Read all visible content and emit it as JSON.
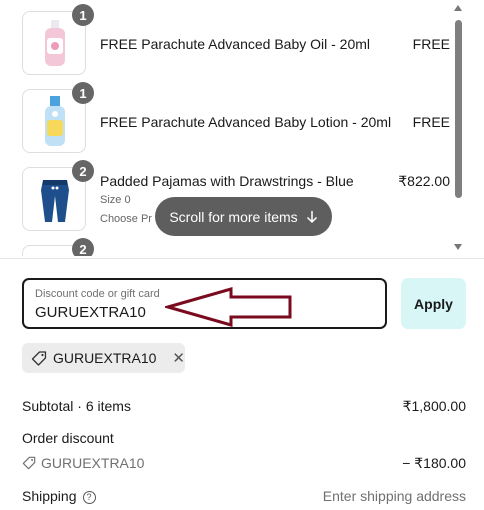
{
  "cart": {
    "items": [
      {
        "quantity": "1",
        "title": "FREE Parachute Advanced Baby Oil - 20ml",
        "price": "FREE",
        "image_icon": "baby-oil-bottle"
      },
      {
        "quantity": "1",
        "title": "FREE Parachute Advanced Baby Lotion - 20ml",
        "price": "FREE",
        "image_icon": "baby-lotion-bottle"
      },
      {
        "quantity": "2",
        "title": "Padded Pajamas with Drawstrings - Blue",
        "price": "₹822.00",
        "size": "Size 0",
        "note": "Choose Pr"
      },
      {
        "quantity": "2"
      }
    ],
    "scroll_hint": "Scroll for more items"
  },
  "discount": {
    "label": "Discount code or gift card",
    "value": "GURUEXTRA10",
    "apply_label": "Apply",
    "applied_code": "GURUEXTRA10"
  },
  "summary": {
    "subtotal_label": "Subtotal · 6 items",
    "subtotal_value": "₹1,800.00",
    "order_discount_label": "Order discount",
    "order_discount_code": "GURUEXTRA10",
    "order_discount_value": "− ₹180.00",
    "shipping_label": "Shipping",
    "shipping_value": "Enter shipping address"
  },
  "colors": {
    "apply_bg": "#d9f6f7",
    "arrow": "#7a0a1e",
    "badge": "#666666"
  }
}
